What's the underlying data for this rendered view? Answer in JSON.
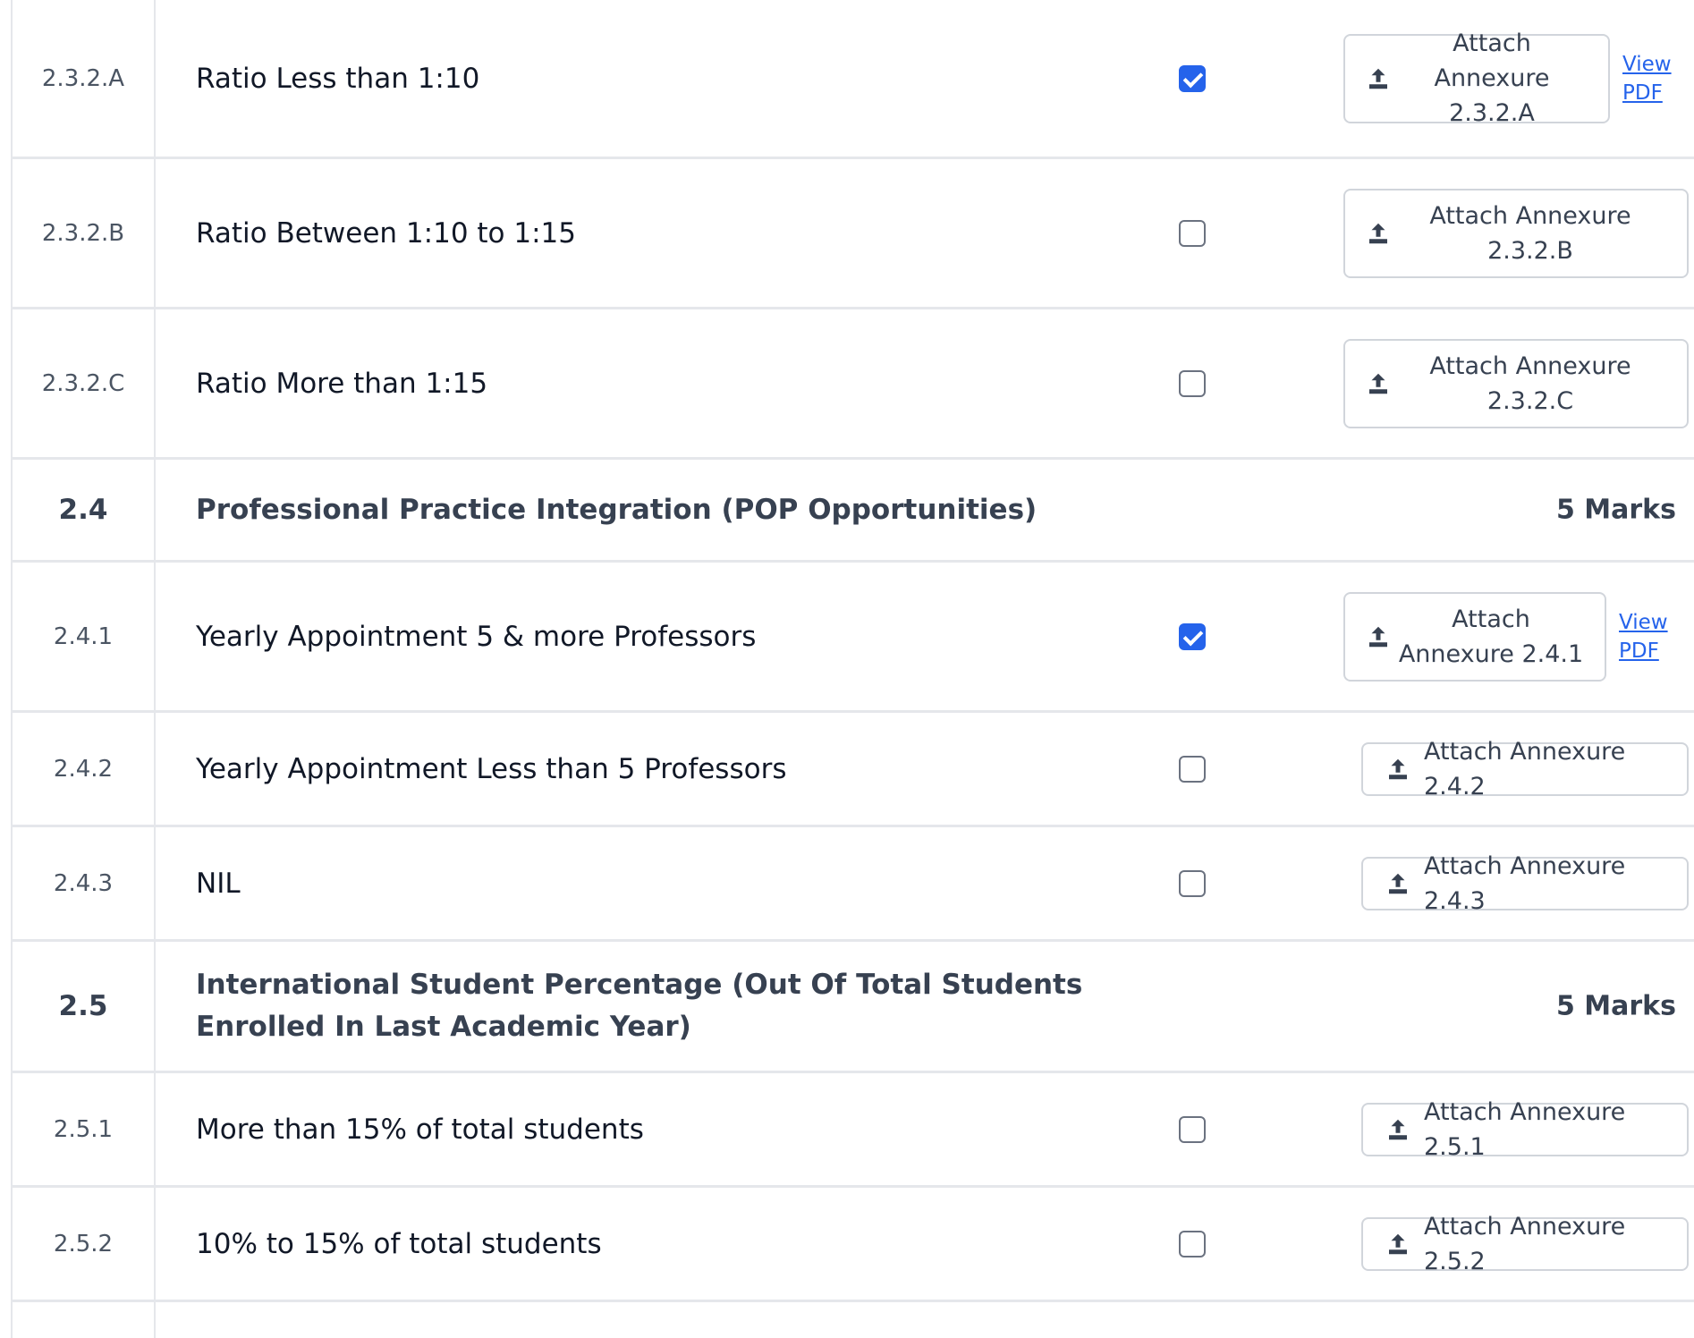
{
  "icons": {
    "upload": "upload-icon",
    "checkbox_checked_color": "#2563eb"
  },
  "rows": [
    {
      "code": "2.3.2.A",
      "label": "Ratio Less than 1:10",
      "checked": true,
      "attach_label": "Attach Annexure 2.3.2.A",
      "view_link": "View PDF"
    },
    {
      "code": "2.3.2.B",
      "label": "Ratio Between 1:10 to 1:15",
      "checked": false,
      "attach_label": "Attach Annexure 2.3.2.B"
    },
    {
      "code": "2.3.2.C",
      "label": "Ratio More than 1:15",
      "checked": false,
      "attach_label": "Attach Annexure 2.3.2.C"
    },
    {
      "code": "2.4",
      "label": "Professional Practice Integration (POP Opportunities)",
      "marks": "5 Marks",
      "section": true
    },
    {
      "code": "2.4.1",
      "label": "Yearly Appointment 5 & more Professors",
      "checked": true,
      "attach_label": "Attach Annexure 2.4.1",
      "view_link": "View PDF"
    },
    {
      "code": "2.4.2",
      "label": "Yearly Appointment Less than 5 Professors",
      "checked": false,
      "attach_label": "Attach Annexure 2.4.2"
    },
    {
      "code": "2.4.3",
      "label": "NIL",
      "checked": false,
      "attach_label": "Attach Annexure 2.4.3"
    },
    {
      "code": "2.5",
      "label": "International Student Percentage (Out Of Total Students Enrolled In Last Academic Year)",
      "marks": "5 Marks",
      "section": true
    },
    {
      "code": "2.5.1",
      "label": "More than 15% of total students",
      "checked": false,
      "attach_label": "Attach Annexure 2.5.1"
    },
    {
      "code": "2.5.2",
      "label": "10% to 15% of total students",
      "checked": false,
      "attach_label": "Attach Annexure 2.5.2"
    }
  ]
}
